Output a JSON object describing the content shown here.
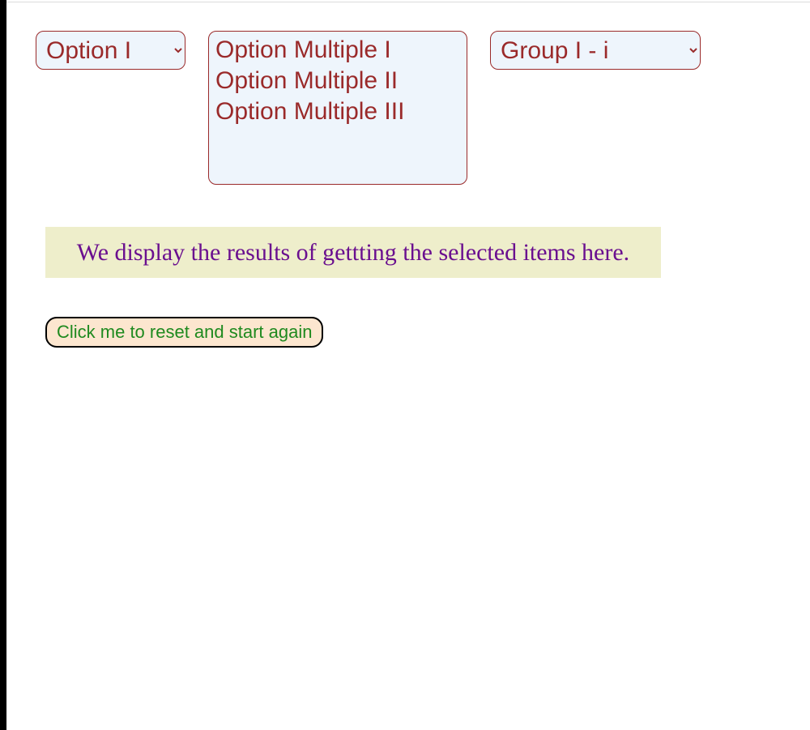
{
  "select_single": {
    "selected": "Option I",
    "options": [
      "Option I"
    ]
  },
  "select_multiple": {
    "options": [
      "Option Multiple I",
      "Option Multiple II",
      "Option Multiple III"
    ]
  },
  "select_grouped": {
    "selected": "Group I - i",
    "options": [
      "Group I - i"
    ]
  },
  "results_text": "We display the results of gettting the selected items here.",
  "reset_button_label": "Click me to reset and start again"
}
